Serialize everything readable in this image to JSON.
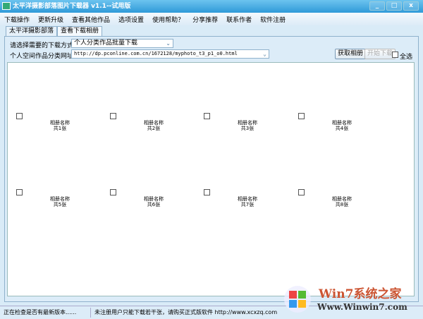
{
  "window": {
    "title": "太平洋摄影部落图片下载器 v1.1--试用版",
    "minimize": "_",
    "maximize": "□",
    "close": "x"
  },
  "menu": [
    "下载操作",
    "更新升级",
    "查看其他作品",
    "选项设置",
    "使用帮助？",
    "分享推荐",
    "联系作者",
    "软件注册"
  ],
  "tabs": [
    "太平洋摄影部落",
    "查看下载相册"
  ],
  "form": {
    "mode_label": "请选择需要的下载方式：",
    "mode_value": "个人分类作品批量下载",
    "url_label": "个人空间作品分类网址：",
    "url_value": "http://dp.pconline.com.cn/1672128/myphoto_t3_p1_o0.html",
    "get_albums": "获取相册",
    "start_download": "开始下载",
    "select_all": "全选"
  },
  "albums": [
    {
      "name": "相册名称",
      "count": "共1张"
    },
    {
      "name": "相册名称",
      "count": "共2张"
    },
    {
      "name": "相册名称",
      "count": "共3张"
    },
    {
      "name": "相册名称",
      "count": "共4张"
    },
    {
      "name": "相册名称",
      "count": "共5张"
    },
    {
      "name": "相册名称",
      "count": "共6张"
    },
    {
      "name": "相册名称",
      "count": "共7张"
    },
    {
      "name": "相册名称",
      "count": "共8张"
    }
  ],
  "status": {
    "left": "正在检查是否有最新版本......",
    "right": "未注册用户只能下载若干张，请购买正式版软件 http://www.xcxzq.com"
  },
  "watermark": {
    "brand": "Win7系统之家",
    "url": "Www.Winwin7.com"
  }
}
